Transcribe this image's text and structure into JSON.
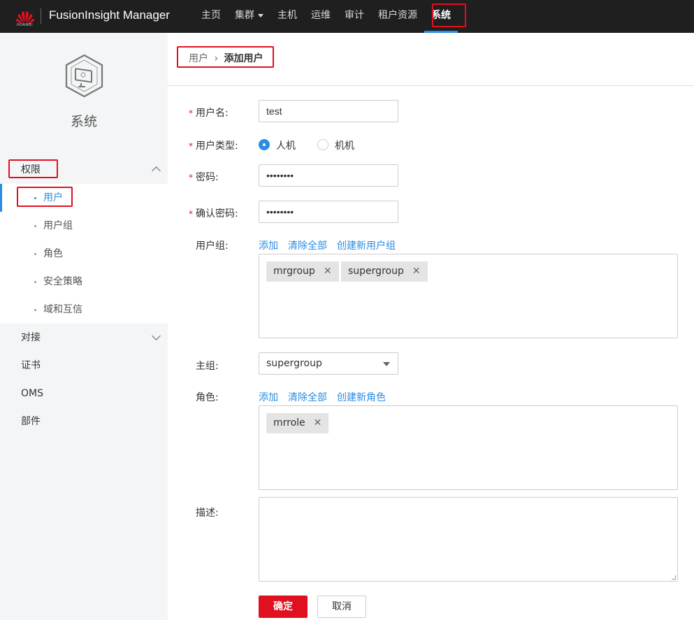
{
  "header": {
    "logo_text": "HUAWEI",
    "app_title": "FusionInsight Manager",
    "nav": [
      {
        "label": "主页"
      },
      {
        "label": "集群"
      },
      {
        "label": "主机"
      },
      {
        "label": "运维"
      },
      {
        "label": "审计"
      },
      {
        "label": "租户资源"
      },
      {
        "label": "系统"
      }
    ],
    "active_nav": "系统"
  },
  "sidebar": {
    "title": "系统",
    "groups": [
      {
        "label": "权限",
        "expanded": true
      },
      {
        "label": "对接",
        "expanded": false
      },
      {
        "label": "证书"
      },
      {
        "label": "OMS"
      },
      {
        "label": "部件"
      }
    ],
    "permission_items": [
      {
        "label": "用户",
        "active": true
      },
      {
        "label": "用户组"
      },
      {
        "label": "角色"
      },
      {
        "label": "安全策略"
      },
      {
        "label": "域和互信"
      }
    ]
  },
  "breadcrumb": {
    "parent": "用户",
    "separator": "›",
    "current": "添加用户"
  },
  "form": {
    "required_mark": "*",
    "username_label": "用户名:",
    "username_value": "test",
    "user_type_label": "用户类型:",
    "user_type_options": [
      "人机",
      "机机"
    ],
    "user_type_selected": "人机",
    "password_label": "密码:",
    "password_value": "••••••••",
    "confirm_password_label": "确认密码:",
    "confirm_password_value": "••••••••",
    "user_group_label": "用户组:",
    "user_group_actions": [
      "添加",
      "清除全部",
      "创建新用户组"
    ],
    "user_groups": [
      "mrgroup",
      "supergroup"
    ],
    "primary_group_label": "主组:",
    "primary_group_value": "supergroup",
    "role_label": "角色:",
    "role_actions": [
      "添加",
      "清除全部",
      "创建新角色"
    ],
    "roles": [
      "mrrole"
    ],
    "description_label": "描述:",
    "description_value": "",
    "tag_remove": "✕"
  },
  "buttons": {
    "ok": "确定",
    "cancel": "取消"
  },
  "colors": {
    "accent": "#2a8ce3",
    "primary_button": "#e01020",
    "highlight_box": "#e01020",
    "topbar": "#1f1f1f"
  }
}
